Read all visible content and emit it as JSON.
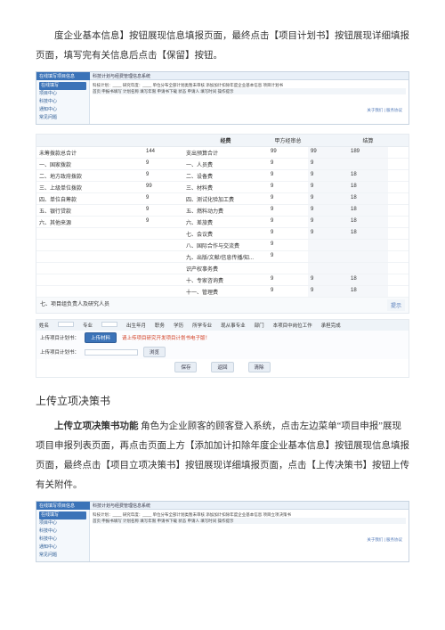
{
  "intro_para": "度企业基本信息】按钮展现信息填报页面，最终点击【项目计划书】按钮展现详细填报页面，填写完有关信息后点击【保留】按钮。",
  "shot1": {
    "title_l": "在线填写项目信息",
    "title_r": "科技计划与经费管理信息系统",
    "nav": [
      "项目中心",
      "科技中心",
      "通知中心",
      "常见问题"
    ],
    "nav_hl": "在线填写",
    "row0": "科技计划：____  研究年度：____  单位分布全部计划类暂未审核  添加加计扣除年度企业基本信息  项目计划书",
    "row1": "首页  申报书填写  计划名称  填写年限  申请书下载  状态  申请人  填写时间  操作提示",
    "foot": "关于我们 | 服务协议"
  },
  "budget": {
    "col_headers": [
      "",
      "",
      "经费",
      "甲方经审总",
      "结算"
    ],
    "rows_left": [
      {
        "label": "未筹拨款总合计",
        "value": "144"
      },
      {
        "label": "一、国家拨款",
        "value": "9"
      },
      {
        "label": "二、地方政府拨款",
        "value": "9"
      },
      {
        "label": "三、上级单位拨款",
        "value": "99"
      },
      {
        "label": "四、单位自筹款",
        "value": "9"
      },
      {
        "label": "五、银行贷款",
        "value": "9"
      },
      {
        "label": "六、其他来源",
        "value": "9"
      }
    ],
    "rows_right": [
      {
        "label": "支出预算合计",
        "v1": "99",
        "v2": "99",
        "v3": "189"
      },
      {
        "label": "一、人员费",
        "v1": "9",
        "v2": "9",
        "v3": ""
      },
      {
        "label": "二、设备费",
        "v1": "9",
        "v2": "9",
        "v3": "18"
      },
      {
        "label": "三、材料费",
        "v1": "9",
        "v2": "9",
        "v3": "18"
      },
      {
        "label": "四、测试化验加工费",
        "v1": "9",
        "v2": "9",
        "v3": "18"
      },
      {
        "label": "五、燃料动力费",
        "v1": "9",
        "v2": "9",
        "v3": "18"
      },
      {
        "label": "六、差旅费",
        "v1": "9",
        "v2": "9",
        "v3": "18"
      },
      {
        "label": "七、会议费",
        "v1": "9",
        "v2": "9",
        "v3": "18"
      },
      {
        "label": "八、国际合作与交流费",
        "v1": "9",
        "v2": "",
        "v3": ""
      },
      {
        "label": "九、出版/文献/信息传播/知...",
        "v1": "9",
        "v2": "",
        "v3": ""
      },
      {
        "label": "识产权事务费",
        "v1": "",
        "v2": "",
        "v3": ""
      },
      {
        "label": "十、专家咨询费",
        "v1": "9",
        "v2": "9",
        "v3": "18"
      },
      {
        "label": "十一、管理费",
        "v1": "9",
        "v2": "9",
        "v3": "18"
      }
    ],
    "section7": "七、项目组负责人及研究人员",
    "note": "提示"
  },
  "form": {
    "hdr": [
      "姓名",
      "专业",
      "出生年月",
      "职务",
      "学历",
      "所学专业",
      "现从事专业",
      "部门",
      "本项目中岗位工作",
      "承担完成"
    ],
    "upload_label": "上传项目计划书：",
    "upload_btn": "上传材料",
    "upload_warn": "请上传项目研究开发项目计划书电子版！",
    "upload2_label": "上传项目计划书：",
    "browse_btn": "浏览",
    "btns": [
      "保存",
      "返回",
      "清除"
    ]
  },
  "section_title": "上传立项决策书",
  "para2": "上传立项决策书功能   角色为企业顾客的顾客登入系统，点击左边菜单“项目申报”展现项目申报列表页面，再点击页面上方【添加加计扣除年度企业基本信息】按钮展现信息填报页面，最终点击【项目立项决策书】按钮展现详细填报页面，点击【上传决策书】按钮上传有关附件。",
  "shot2": {
    "title_l": "在线填写项目信息",
    "title_r": "科技计划与经费管理信息系统",
    "nav": [
      "项目中心",
      "科技中心",
      "科技中心",
      "通知中心",
      "常见问题"
    ],
    "nav_hl": "在线填写",
    "row0": "科技计划：____  研究年度：____  单位分布全部计划类暂未审核  添加加计扣除年度企业基本信息  项目立项决策书",
    "row1": "首页  申报书填写  计划名称  填写年限  申请书下载  状态  申请人  填写时间  操作提示",
    "foot": "关于我们 | 服务协议"
  }
}
